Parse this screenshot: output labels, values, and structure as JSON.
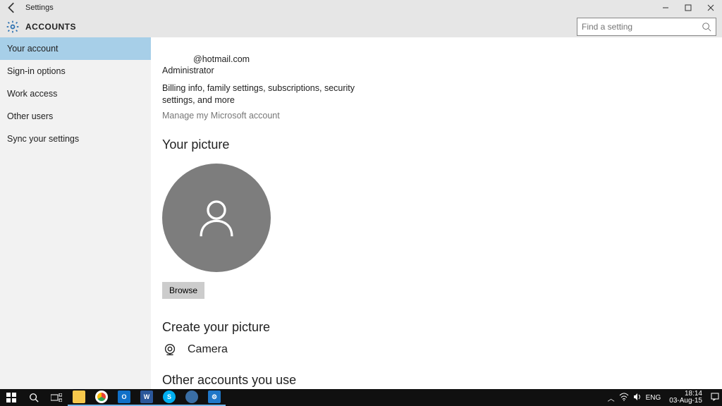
{
  "window": {
    "title": "Settings"
  },
  "header": {
    "section": "ACCOUNTS",
    "search_placeholder": "Find a setting"
  },
  "sidebar": {
    "items": [
      {
        "label": "Your account",
        "active": true
      },
      {
        "label": "Sign-in options",
        "active": false
      },
      {
        "label": "Work access",
        "active": false
      },
      {
        "label": "Other users",
        "active": false
      },
      {
        "label": "Sync your settings",
        "active": false
      }
    ]
  },
  "account": {
    "email": "@hotmail.com",
    "role": "Administrator",
    "description": "Billing info, family settings, subscriptions, security settings, and more",
    "manage_link": "Manage my Microsoft account",
    "picture_heading": "Your picture",
    "browse_label": "Browse",
    "create_heading": "Create your picture",
    "camera_label": "Camera",
    "other_accounts_heading": "Other accounts you use"
  },
  "taskbar": {
    "lang": "ENG",
    "time": "18:14",
    "date": "03-Aug-15"
  }
}
